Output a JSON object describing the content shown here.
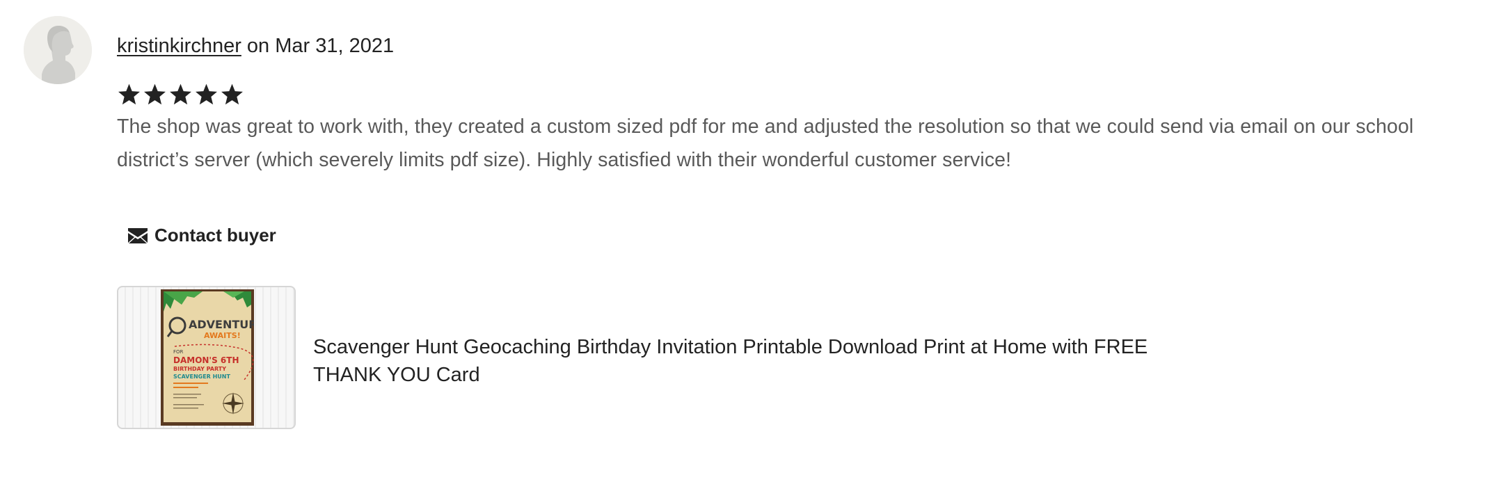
{
  "review": {
    "username": "kristinkirchner",
    "date_text": " on Mar 31, 2021",
    "rating": 5,
    "rating_max": 5,
    "text": "The shop was great to work with, they created a custom sized pdf for me and adjusted the resolution so that we could send via email on our school district’s server (which severely limits pdf size). Highly satisfied with their wonderful customer service!",
    "contact_label": "Contact buyer"
  },
  "listing": {
    "title": "Scavenger Hunt Geocaching Birthday Invitation Printable Download Print at Home with FREE THANK YOU Card",
    "thumbnail": {
      "line1": "ADVENTURE",
      "line2": "AWAITS!",
      "line3": "FOR",
      "line4": "DAMON'S 6TH",
      "line5": "BIRTHDAY PARTY",
      "line6": "SCAVENGER HUNT"
    }
  },
  "icons": {
    "avatar": "default-user-avatar-icon",
    "star": "star-icon",
    "contact": "mail-icon"
  },
  "colors": {
    "text": "#222222",
    "review_text": "#595959",
    "star": "#222222",
    "avatar_bg": "#efeeea",
    "thumb_border": "#d6d6d6"
  }
}
